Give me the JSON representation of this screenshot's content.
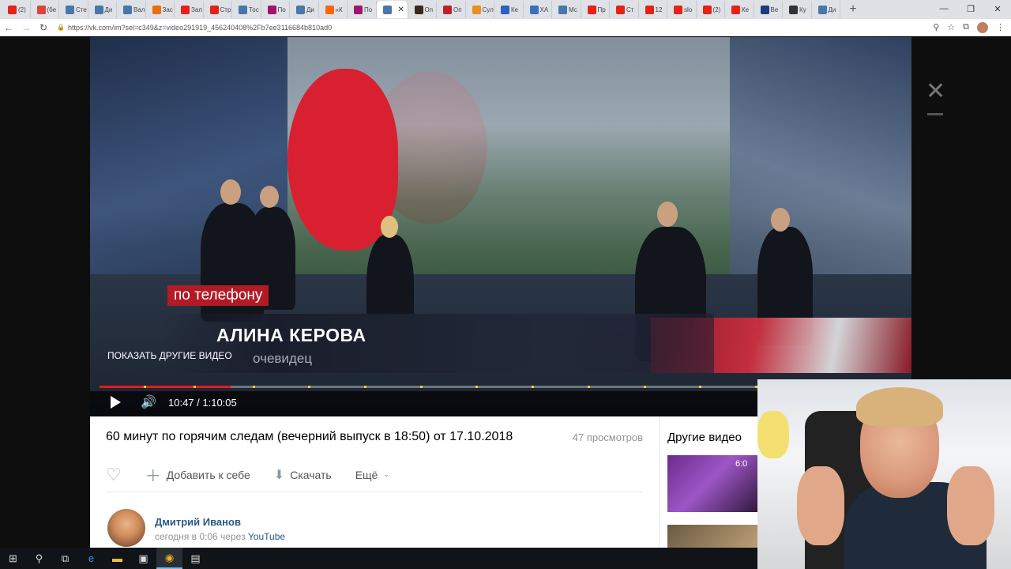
{
  "browser": {
    "tabs": [
      {
        "label": "(2)",
        "color": "#e62117"
      },
      {
        "label": "(бе",
        "color": "#db4437"
      },
      {
        "label": "Сте",
        "color": "#4a76a8"
      },
      {
        "label": "Ди",
        "color": "#4a76a8"
      },
      {
        "label": "Вал",
        "color": "#4a76a8"
      },
      {
        "label": "Зас",
        "color": "#e8710a"
      },
      {
        "label": "Зал",
        "color": "#e62117"
      },
      {
        "label": "Стр",
        "color": "#e62117"
      },
      {
        "label": "Тос",
        "color": "#4a76a8"
      },
      {
        "label": "По",
        "color": "#a0156a"
      },
      {
        "label": "Ди",
        "color": "#4a76a8"
      },
      {
        "label": "«К",
        "color": "#ff6600"
      },
      {
        "label": "По",
        "color": "#a0156a"
      },
      {
        "label": "",
        "color": "#4a76a8"
      },
      {
        "label": "Оп",
        "color": "#3a2a1a"
      },
      {
        "label": "Оп",
        "color": "#c0202a"
      },
      {
        "label": "Сул",
        "color": "#e89020"
      },
      {
        "label": "Ке",
        "color": "#3060c0"
      },
      {
        "label": "ХА",
        "color": "#3a70c0"
      },
      {
        "label": "Мс",
        "color": "#4a76a8"
      },
      {
        "label": "Пр",
        "color": "#e62117"
      },
      {
        "label": "Ст",
        "color": "#e62117"
      },
      {
        "label": "12",
        "color": "#e62117"
      },
      {
        "label": "slo",
        "color": "#e62117"
      },
      {
        "label": "(2)",
        "color": "#e62117"
      },
      {
        "label": "Ке",
        "color": "#e62117"
      },
      {
        "label": "Ве",
        "color": "#1d3b7a"
      },
      {
        "label": "Ку",
        "color": "#333333"
      },
      {
        "label": "Ди",
        "color": "#4a76a8"
      }
    ],
    "active_tab_index": 13,
    "new_tab_symbol": "+",
    "url": "https://vk.com/im?sel=c349&z=video291919_456240408%2Fb7ee3116684b810ad0"
  },
  "player": {
    "phone_tag": "по телефону",
    "name_caption": "АЛИНА КЕРОВА",
    "role_caption": "очевидец",
    "show_other_videos": "ПОКАЗАТЬ ДРУГИЕ ВИДЕО",
    "time": "10:47 / 1:10:05",
    "progress": 0.2,
    "chapter_ticks": [
      0.07,
      0.145,
      0.235,
      0.32,
      0.405,
      0.49,
      0.575,
      0.66,
      0.745,
      0.83,
      0.915,
      1.0
    ]
  },
  "video_info": {
    "title": "60 минут по горячим следам (вечерний выпуск в 18:50) от 17.10.2018",
    "views": "47 просмотров",
    "add_label": "Добавить к себе",
    "download_label": "Скачать",
    "more_label": "Ещё",
    "author_name": "Дмитрий Иванов",
    "author_meta_prefix": "сегодня в 0:06 через ",
    "author_source": "YouTube"
  },
  "sidebar": {
    "title": "Другие видео",
    "thumb1_duration": "6:0"
  }
}
